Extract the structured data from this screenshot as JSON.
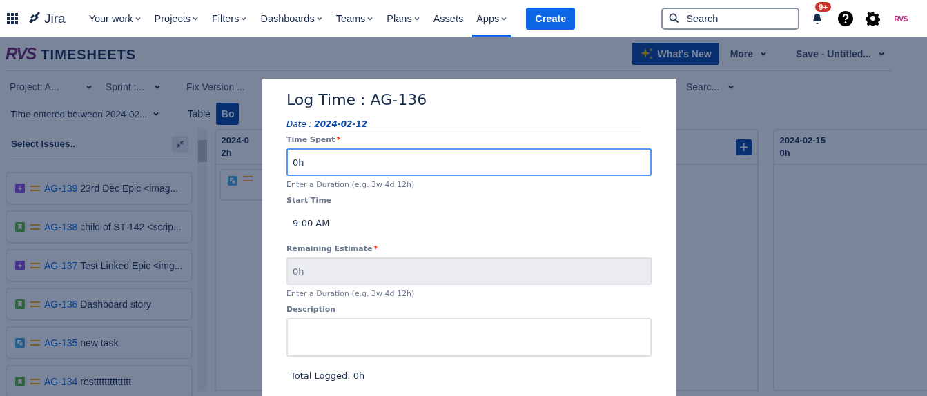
{
  "topnav": {
    "product": "Jira",
    "items": [
      {
        "label": "Your work",
        "dropdown": true,
        "selected": false
      },
      {
        "label": "Projects",
        "dropdown": true,
        "selected": false
      },
      {
        "label": "Filters",
        "dropdown": true,
        "selected": false
      },
      {
        "label": "Dashboards",
        "dropdown": true,
        "selected": false
      },
      {
        "label": "Teams",
        "dropdown": true,
        "selected": false
      },
      {
        "label": "Plans",
        "dropdown": true,
        "selected": false
      },
      {
        "label": "Assets",
        "dropdown": false,
        "selected": false
      },
      {
        "label": "Apps",
        "dropdown": true,
        "selected": true
      }
    ],
    "create_button": "Create",
    "search": {
      "placeholder": "Search"
    },
    "notifications_badge": "9+",
    "avatar": "RVS"
  },
  "app_header": {
    "logo": "RVS",
    "title": "TIMESHEETS",
    "whats_new": "What's New",
    "more": "More",
    "save": "Save - Untitled..."
  },
  "filters": [
    "Project: A...",
    "Sprint :...",
    "Fix Version ..."
  ],
  "search_filter": "Searc...",
  "date_range": "Time entered between 2024-02...",
  "view_tabs": [
    {
      "label": "Table",
      "selected": false
    },
    {
      "label": "Bo",
      "selected": true
    }
  ],
  "issue_panel": {
    "title": "Select Issues..",
    "issues": [
      {
        "key": "AG-139",
        "summary": "23rd Dec Epic <imag...",
        "kind": "epic"
      },
      {
        "key": "AG-138",
        "summary": "child of ST 142 <scrip...",
        "kind": "story"
      },
      {
        "key": "AG-137",
        "summary": "Test Linked Epic <img...",
        "kind": "epic"
      },
      {
        "key": "AG-136",
        "summary": "Dashboard story",
        "kind": "story"
      },
      {
        "key": "AG-135",
        "summary": "new task",
        "kind": "task"
      },
      {
        "key": "AG-134",
        "summary": "restttttttttttttt",
        "kind": "story"
      }
    ]
  },
  "columns": [
    {
      "date": "2024-0",
      "total": "2h",
      "add_button": false,
      "cards": [
        {
          "kind": "task"
        }
      ]
    },
    {
      "add_button": true
    },
    {
      "date": "2024-02-15",
      "total": "0h",
      "add_button": false
    }
  ],
  "dialog": {
    "title": "Log Time : AG-136",
    "date_line": "Date : **2024-02-12**",
    "fields": [
      {
        "label": "Time Spent",
        "kind": "input",
        "required_mark": "*",
        "focused": true,
        "disabled": false,
        "value": "0h",
        "hint": "Enter a Duration (e.g. 3w 4d 12h)"
      },
      {
        "label": "Start Time",
        "kind": "time",
        "value": "9:00 AM"
      },
      {
        "label": "Remaining Estimate",
        "kind": "input",
        "required_mark": "*",
        "focused": false,
        "disabled": true,
        "value": "0h",
        "hint": "Enter a Duration (e.g. 3w 4d 12h)"
      },
      {
        "label": "Description",
        "kind": "textarea"
      }
    ],
    "total": "Total Logged: 0h"
  }
}
